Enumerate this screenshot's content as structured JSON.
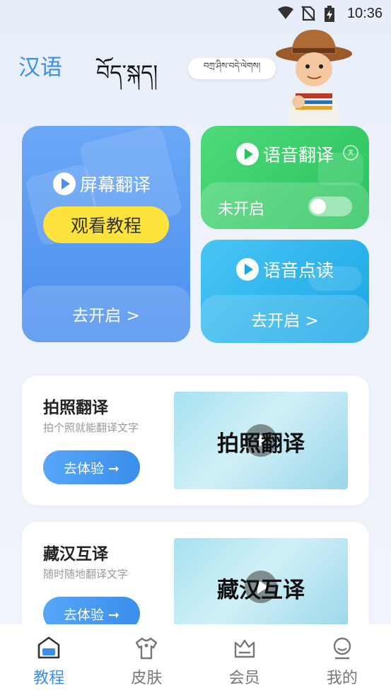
{
  "status_bar": {
    "time": "10:36"
  },
  "header": {
    "lang_chinese": "汉语",
    "lang_tibetan": "བོད་སྐད།",
    "mascot_bubble": "བཀྲ་ཤིས་བདེ་ལེགས།"
  },
  "screen_translate": {
    "title": "屏幕翻译",
    "tutorial_label": "观看教程",
    "open_label": "去开启 >"
  },
  "voice_translate": {
    "title": "语音翻译",
    "status": "未开启",
    "toggle_on": false
  },
  "voice_read": {
    "title": "语音点读",
    "open_label": "去开启 >"
  },
  "list": [
    {
      "title": "拍照翻译",
      "desc": "拍个照就能翻译文字",
      "button": "去体验 ➞",
      "thumb_text": "拍照翻译"
    },
    {
      "title": "藏汉互译",
      "desc": "随时随地翻译文字",
      "button": "去体验 ➞",
      "thumb_text": "藏汉互译"
    }
  ],
  "nav": {
    "items": [
      {
        "label": "教程",
        "icon": "tutorial-icon"
      },
      {
        "label": "皮肤",
        "icon": "shirt-icon"
      },
      {
        "label": "会员",
        "icon": "crown-icon"
      },
      {
        "label": "我的",
        "icon": "profile-icon"
      }
    ],
    "active_index": 0
  },
  "colors": {
    "accent": "#3b8eea",
    "yellow": "#fde33b",
    "green": "#2cc45d",
    "cyan": "#1ca6e5"
  }
}
